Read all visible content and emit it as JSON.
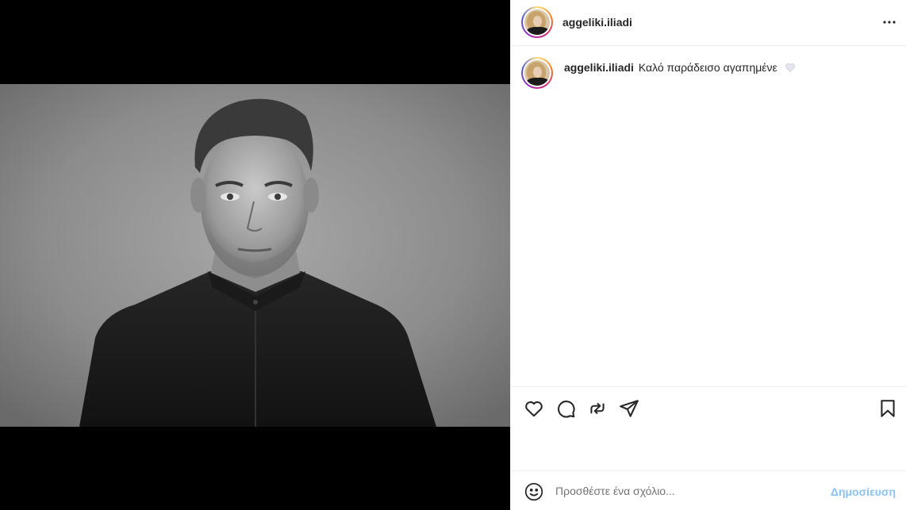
{
  "post": {
    "author": "aggeliki.iliadi",
    "caption_author": "aggeliki.iliadi",
    "caption": "Καλό παράδεισο αγαπημένε",
    "caption_emoji": "white-heart-icon",
    "photo_alt": "Black and white portrait of a man in a dark shirt"
  },
  "icons": {
    "more": "more-options-icon",
    "like": "heart-icon",
    "comment": "comment-icon",
    "repost": "repost-icon",
    "share": "send-icon",
    "save": "bookmark-icon",
    "emoji": "emoji-icon"
  },
  "comment": {
    "placeholder": "Προσθέστε ένα σχόλιο...",
    "post_label": "Δημοσίευση"
  },
  "colors": {
    "post_button": "#8ac3f5",
    "border": "#efefef",
    "text": "#262626"
  }
}
